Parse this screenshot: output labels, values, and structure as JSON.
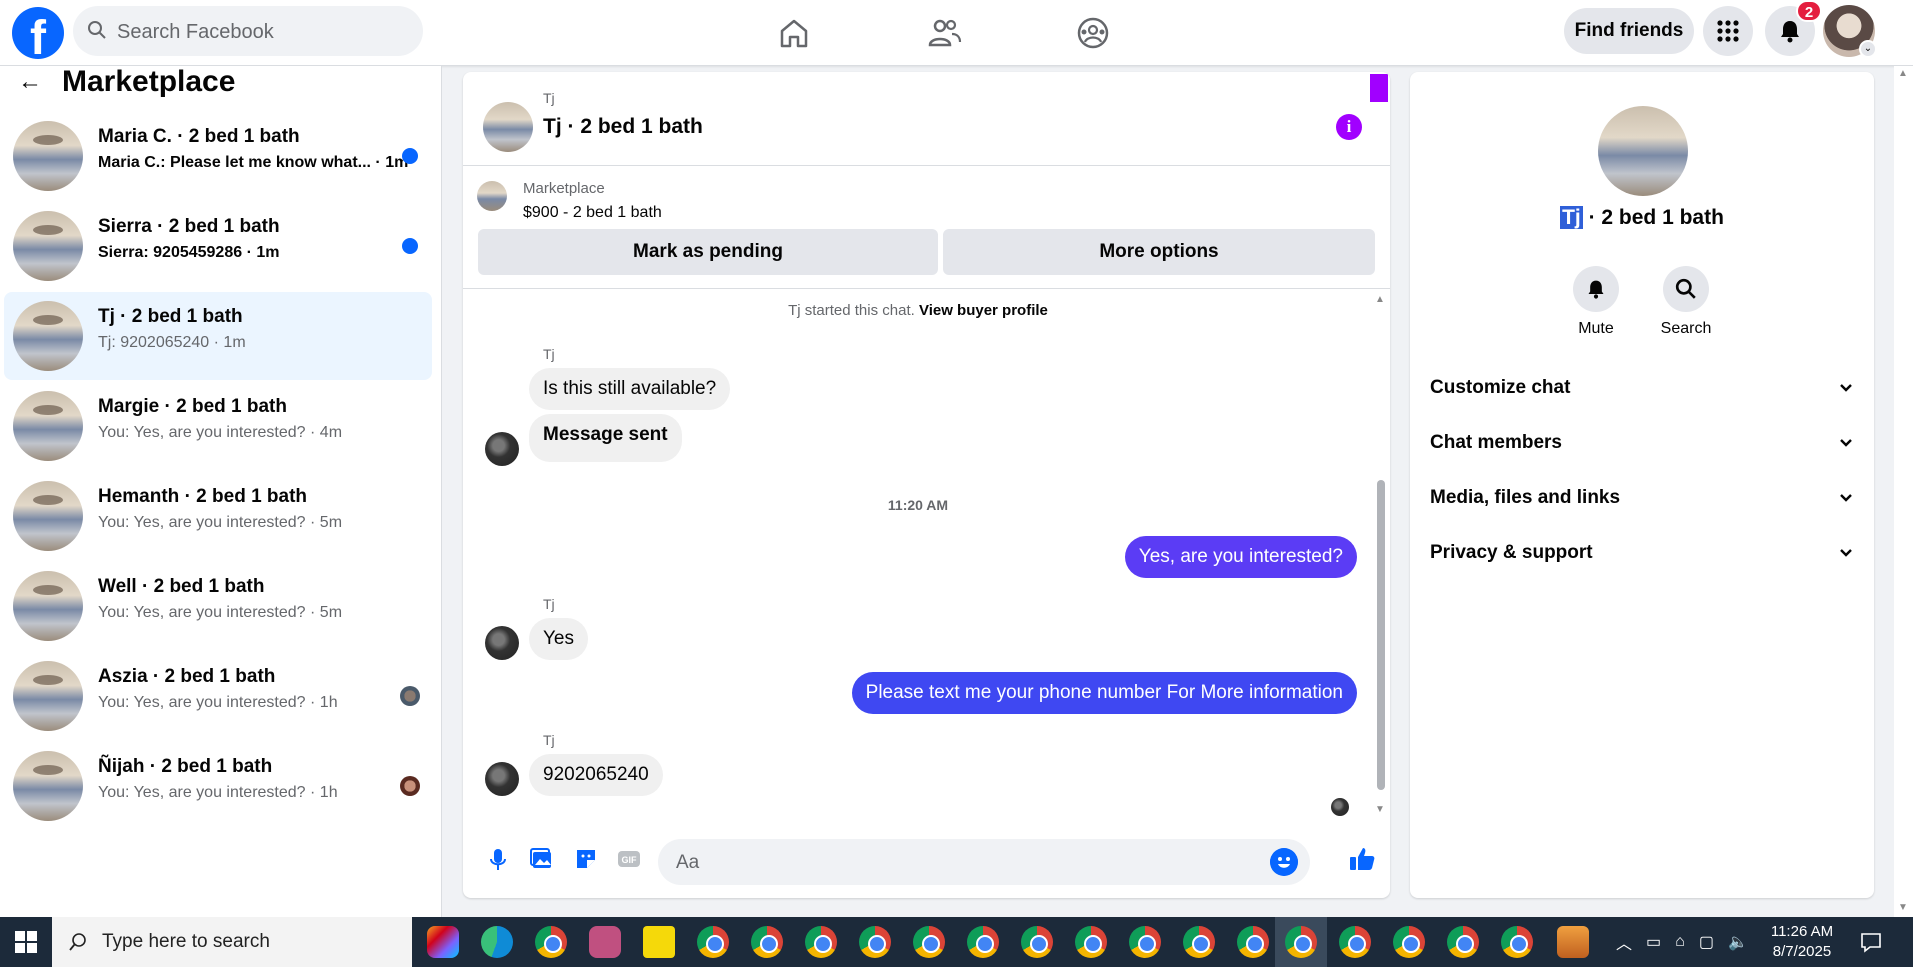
{
  "topnav": {
    "logo": "f",
    "search_placeholder": "Search Facebook",
    "find_friends": "Find friends",
    "notification_count": "2",
    "icons": [
      "home-icon",
      "friends-icon",
      "groups-icon",
      "menu-grid-icon",
      "bell-icon"
    ]
  },
  "left": {
    "title": "Marketplace",
    "conversations": [
      {
        "name": "Maria C. · 2 bed 1 bath",
        "preview": "Maria C.: Please let me know what... · 1m",
        "unread": true
      },
      {
        "name": "Sierra · 2 bed 1 bath",
        "preview": "Sierra: 9205459286 · 1m",
        "unread": true
      },
      {
        "name": "Tj · 2 bed 1 bath",
        "preview": "Tj: 9202065240 · 1m",
        "unread": false
      },
      {
        "name": "Margie · 2 bed 1 bath",
        "preview": "You: Yes, are you interested? · 4m",
        "unread": false
      },
      {
        "name": "Hemanth · 2 bed 1 bath",
        "preview": "You: Yes, are you interested? · 5m",
        "unread": false
      },
      {
        "name": "Well · 2 bed 1 bath",
        "preview": "You: Yes, are you interested? · 5m",
        "unread": false
      },
      {
        "name": "Aszia · 2 bed 1 bath",
        "preview": "You: Yes, are you interested? · 1h",
        "unread": false
      },
      {
        "name": "Ñijah · 2 bed 1 bath",
        "preview": "You: Yes, are you interested? · 1h",
        "unread": false
      }
    ]
  },
  "chat": {
    "header_sub": "Tj",
    "header_title": "Tj · 2 bed 1 bath",
    "listing_source": "Marketplace",
    "listing_price": "$900 - 2 bed 1 bath",
    "mark_pending": "Mark as pending",
    "more_options": "More options",
    "system_text": "Tj started this chat.",
    "system_link": "View buyer profile",
    "sender_name": "Tj",
    "msg1": "Is this still available?",
    "msg2": "Message sent",
    "timestamp": "11:20 AM",
    "out1": "Yes, are you interested?",
    "msg3": "Yes",
    "out2": "Please text me your phone number For More information",
    "msg4": "9202065240",
    "composer_placeholder": "Aa"
  },
  "right": {
    "title_highlight": "Tj",
    "title_rest": " · 2 bed 1 bath",
    "mute": "Mute",
    "search": "Search",
    "rows": [
      "Customize chat",
      "Chat members",
      "Media, files and links",
      "Privacy & support"
    ]
  },
  "taskbar": {
    "search_placeholder": "Type here to search",
    "time": "11:26 AM",
    "date": "8/7/2025"
  },
  "colors": {
    "brand": "#0866ff",
    "outgoing_bubble": "#5b3cf5",
    "accent_purple": "#a100ff"
  }
}
